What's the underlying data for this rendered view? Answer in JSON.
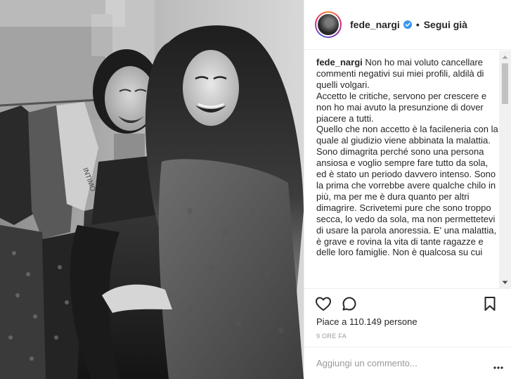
{
  "post": {
    "username": "fede_nargi",
    "follow_status": "Segui già",
    "separator": "•",
    "caption": "Non ho mai voluto cancellare commenti negativi sui miei profili, aldilà di quelli volgari.\nAccetto le critiche, servono per crescere e non ho mai avuto la presunzione di dover piacere a tutti.\nQuello che non accetto è la facileneria con la quale al giudizio viene abbinata la malattia.\nSono dimagrita perché sono una persona ansiosa e voglio sempre fare tutto da sola, ed è stato un periodo davvero intenso. Sono la prima che vorrebbe avere qualche chilo in più, ma per me è dura quanto per altri dimagrire. Scrivetemi pure che sono troppo secca, lo vedo da sola, ma non permettetevi di usare la parola anoressia. E' una malattia, è grave e rovina la vita di tante ragazze e delle loro famiglie. Non è qualcosa su cui",
    "likes_text": "Piace a 110.149 persone",
    "timestamp": "9 ORE FA",
    "comment_placeholder": "Aggiungi un commento...",
    "photo_text": "INTIMO"
  },
  "icons": {
    "verified": "verified-badge-icon",
    "like": "heart-icon",
    "comment": "comment-bubble-icon",
    "save": "bookmark-icon",
    "more": "more-options-icon"
  },
  "colors": {
    "verified": "#3897f0",
    "text": "#262626",
    "muted": "#999999",
    "border": "#efefef"
  }
}
